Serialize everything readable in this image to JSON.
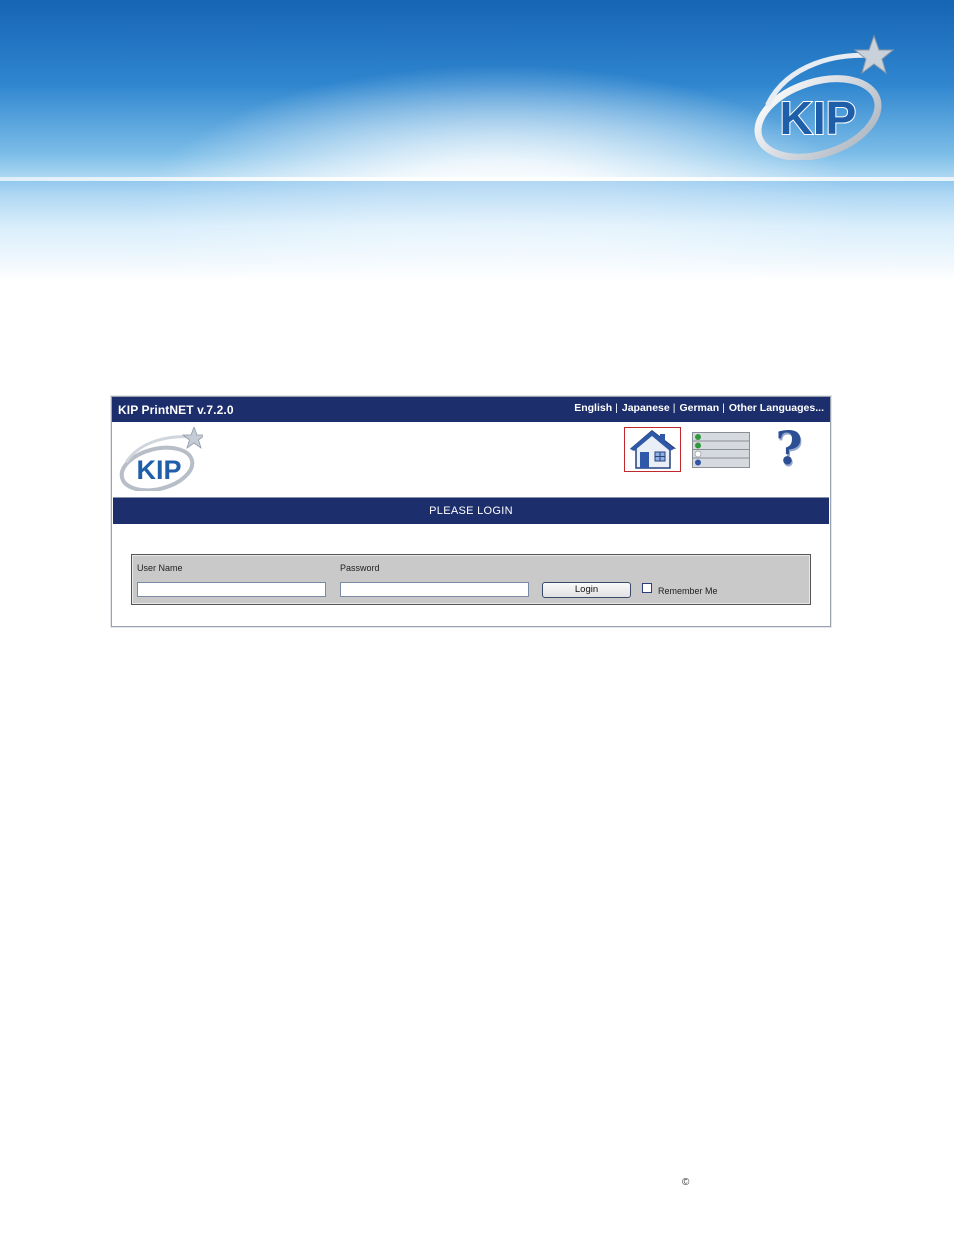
{
  "app": {
    "title": "KIP PrintNET  v.7.2.0",
    "languages": [
      "English",
      "Japanese",
      "German",
      "Other Languages..."
    ],
    "logo_text": "KIP"
  },
  "brand": {
    "logo_text": "KIP"
  },
  "toolbar": {
    "home_icon": "home-icon",
    "queue_icon": "print-queue-icon",
    "help_icon": "help-icon",
    "help_glyph": "?"
  },
  "login": {
    "bar_title": "PLEASE LOGIN",
    "username_label": "User Name",
    "username_value": "",
    "password_label": "Password",
    "password_value": "",
    "login_button": "Login",
    "remember_label": "Remember Me",
    "remember_checked": false
  },
  "footer": {
    "copyright": "©"
  },
  "colors": {
    "nav_bar": "#1c2e6b",
    "accent_blue": "#1f5fa9",
    "home_border": "#c0282e"
  }
}
